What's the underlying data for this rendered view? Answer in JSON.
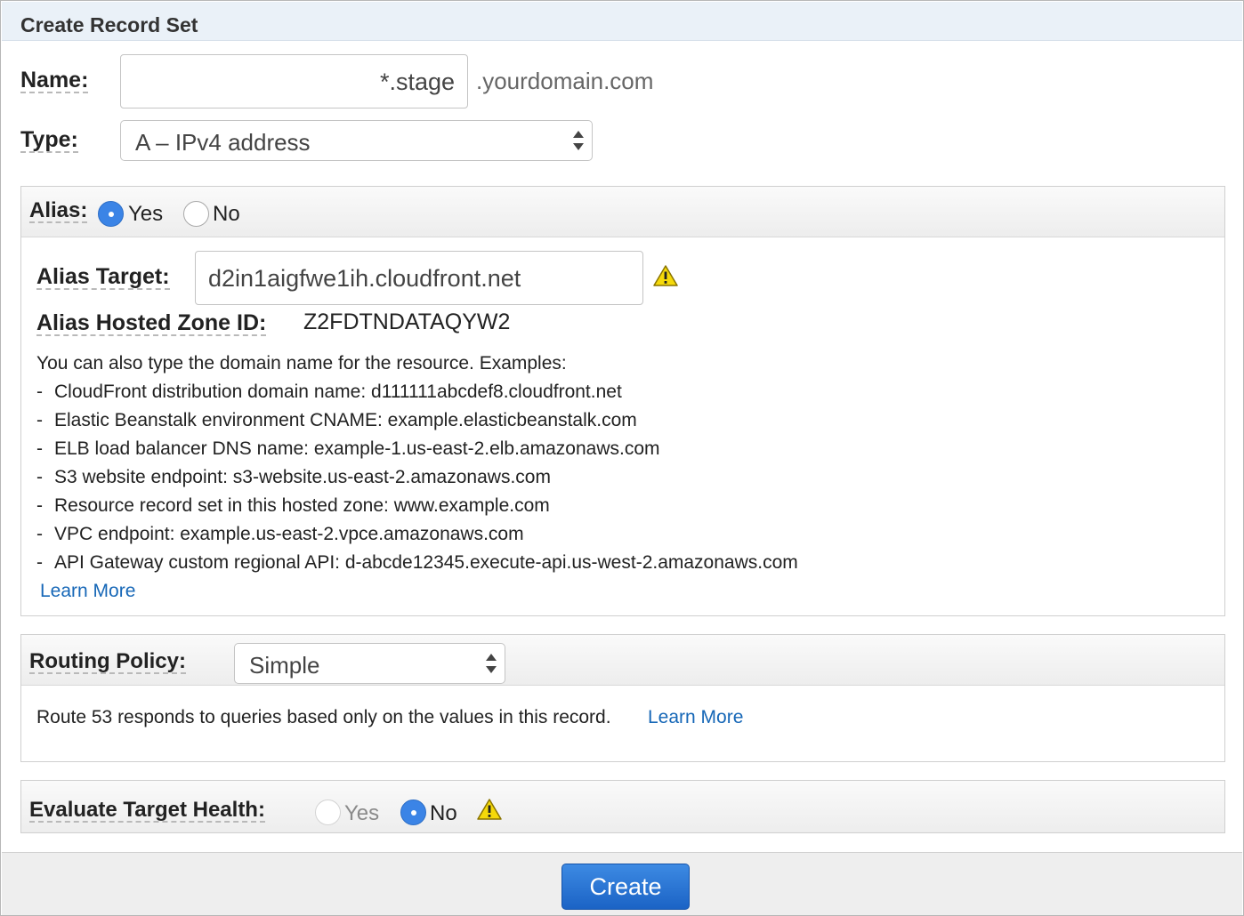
{
  "header": {
    "title": "Create Record Set"
  },
  "name_field": {
    "label": "Name:",
    "value": "*.stage",
    "suffix": ".yourdomain.com"
  },
  "type_field": {
    "label": "Type:",
    "selected": "A – IPv4 address"
  },
  "alias": {
    "label": "Alias:",
    "options": [
      {
        "label": "Yes",
        "selected": true
      },
      {
        "label": "No",
        "selected": false
      }
    ],
    "target_label": "Alias Target:",
    "target_value": "d2in1aigfwe1ih.cloudfront.net",
    "zone_label": "Alias Hosted Zone ID:",
    "zone_value": "Z2FDTNDATAQYW2",
    "intro": "You can also type the domain name for the resource. Examples:",
    "examples": [
      "CloudFront distribution domain name: d111111abcdef8.cloudfront.net",
      "Elastic Beanstalk environment CNAME: example.elasticbeanstalk.com",
      "ELB load balancer DNS name: example-1.us-east-2.elb.amazonaws.com",
      "S3 website endpoint: s3-website.us-east-2.amazonaws.com",
      "Resource record set in this hosted zone: www.example.com",
      "VPC endpoint: example.us-east-2.vpce.amazonaws.com",
      "API Gateway custom regional API: d-abcde12345.execute-api.us-west-2.amazonaws.com"
    ],
    "learn_more": "Learn More"
  },
  "routing": {
    "label": "Routing Policy:",
    "selected": "Simple",
    "description": "Route 53 responds to queries based only on the values in this record.",
    "learn_more": "Learn More"
  },
  "health": {
    "label": "Evaluate Target Health:",
    "options": [
      {
        "label": "Yes",
        "selected": false,
        "disabled": true
      },
      {
        "label": "No",
        "selected": true
      }
    ]
  },
  "footer": {
    "create_label": "Create"
  },
  "colors": {
    "accent": "#3b84e6",
    "link": "#1667b7",
    "header_bg": "#eaf1f8",
    "warning": "#f5d90a"
  }
}
